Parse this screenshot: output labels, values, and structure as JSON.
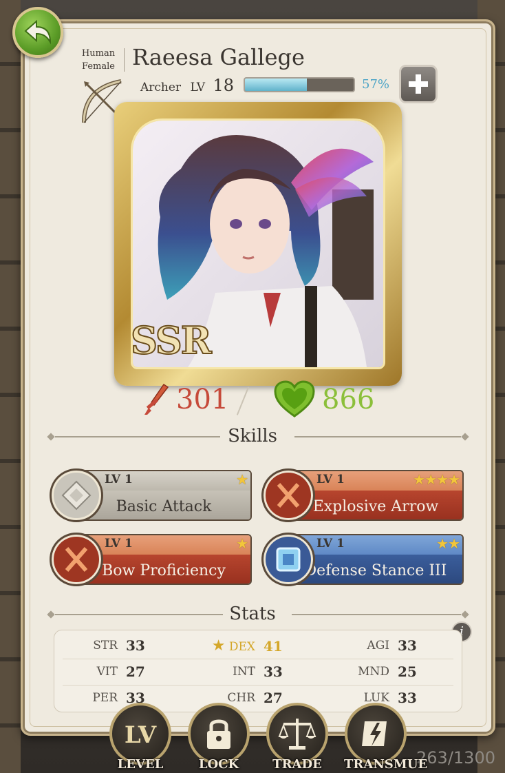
{
  "character": {
    "race": "Human",
    "gender": "Female",
    "name": "Raeesa Gallege",
    "class": "Archer",
    "lv_label": "LV",
    "level": "18",
    "xp_percent": "57%",
    "xp_fraction": 0.57,
    "rarity": "SSR",
    "attack": "301",
    "hp": "866"
  },
  "sections": {
    "skills_title": "Skills",
    "stats_title": "Stats"
  },
  "skills": [
    {
      "lv": "LV 1",
      "name": "Basic Attack",
      "stars": "★",
      "theme": "grey"
    },
    {
      "lv": "LV 1",
      "name": "Explosive Arrow",
      "stars": "★★★★",
      "theme": "red"
    },
    {
      "lv": "LV 1",
      "name": "Bow Proficiency",
      "stars": "★",
      "theme": "red"
    },
    {
      "lv": "LV 1",
      "name": "Defense Stance III",
      "stars": "★★",
      "theme": "blue"
    }
  ],
  "stats": [
    [
      {
        "label": "STR",
        "value": "33"
      },
      {
        "label": "DEX",
        "value": "41",
        "highlight": true
      },
      {
        "label": "AGI",
        "value": "33"
      }
    ],
    [
      {
        "label": "VIT",
        "value": "27"
      },
      {
        "label": "INT",
        "value": "33"
      },
      {
        "label": "MND",
        "value": "25"
      }
    ],
    [
      {
        "label": "PER",
        "value": "33"
      },
      {
        "label": "CHR",
        "value": "27"
      },
      {
        "label": "LUK",
        "value": "33"
      }
    ]
  ],
  "actions": [
    {
      "label": "LEVEL",
      "icon": "lv-icon"
    },
    {
      "label": "LOCK",
      "icon": "lock-icon"
    },
    {
      "label": "TRADE",
      "icon": "scales-icon"
    },
    {
      "label": "TRANSMUE",
      "icon": "transmute-icon"
    }
  ],
  "background_counter": "263/1300",
  "colors": {
    "attack": "#c64a3a",
    "hp": "#8bbf3a",
    "xp": "#4aa3c6",
    "highlight_stat": "#d4a72a"
  }
}
